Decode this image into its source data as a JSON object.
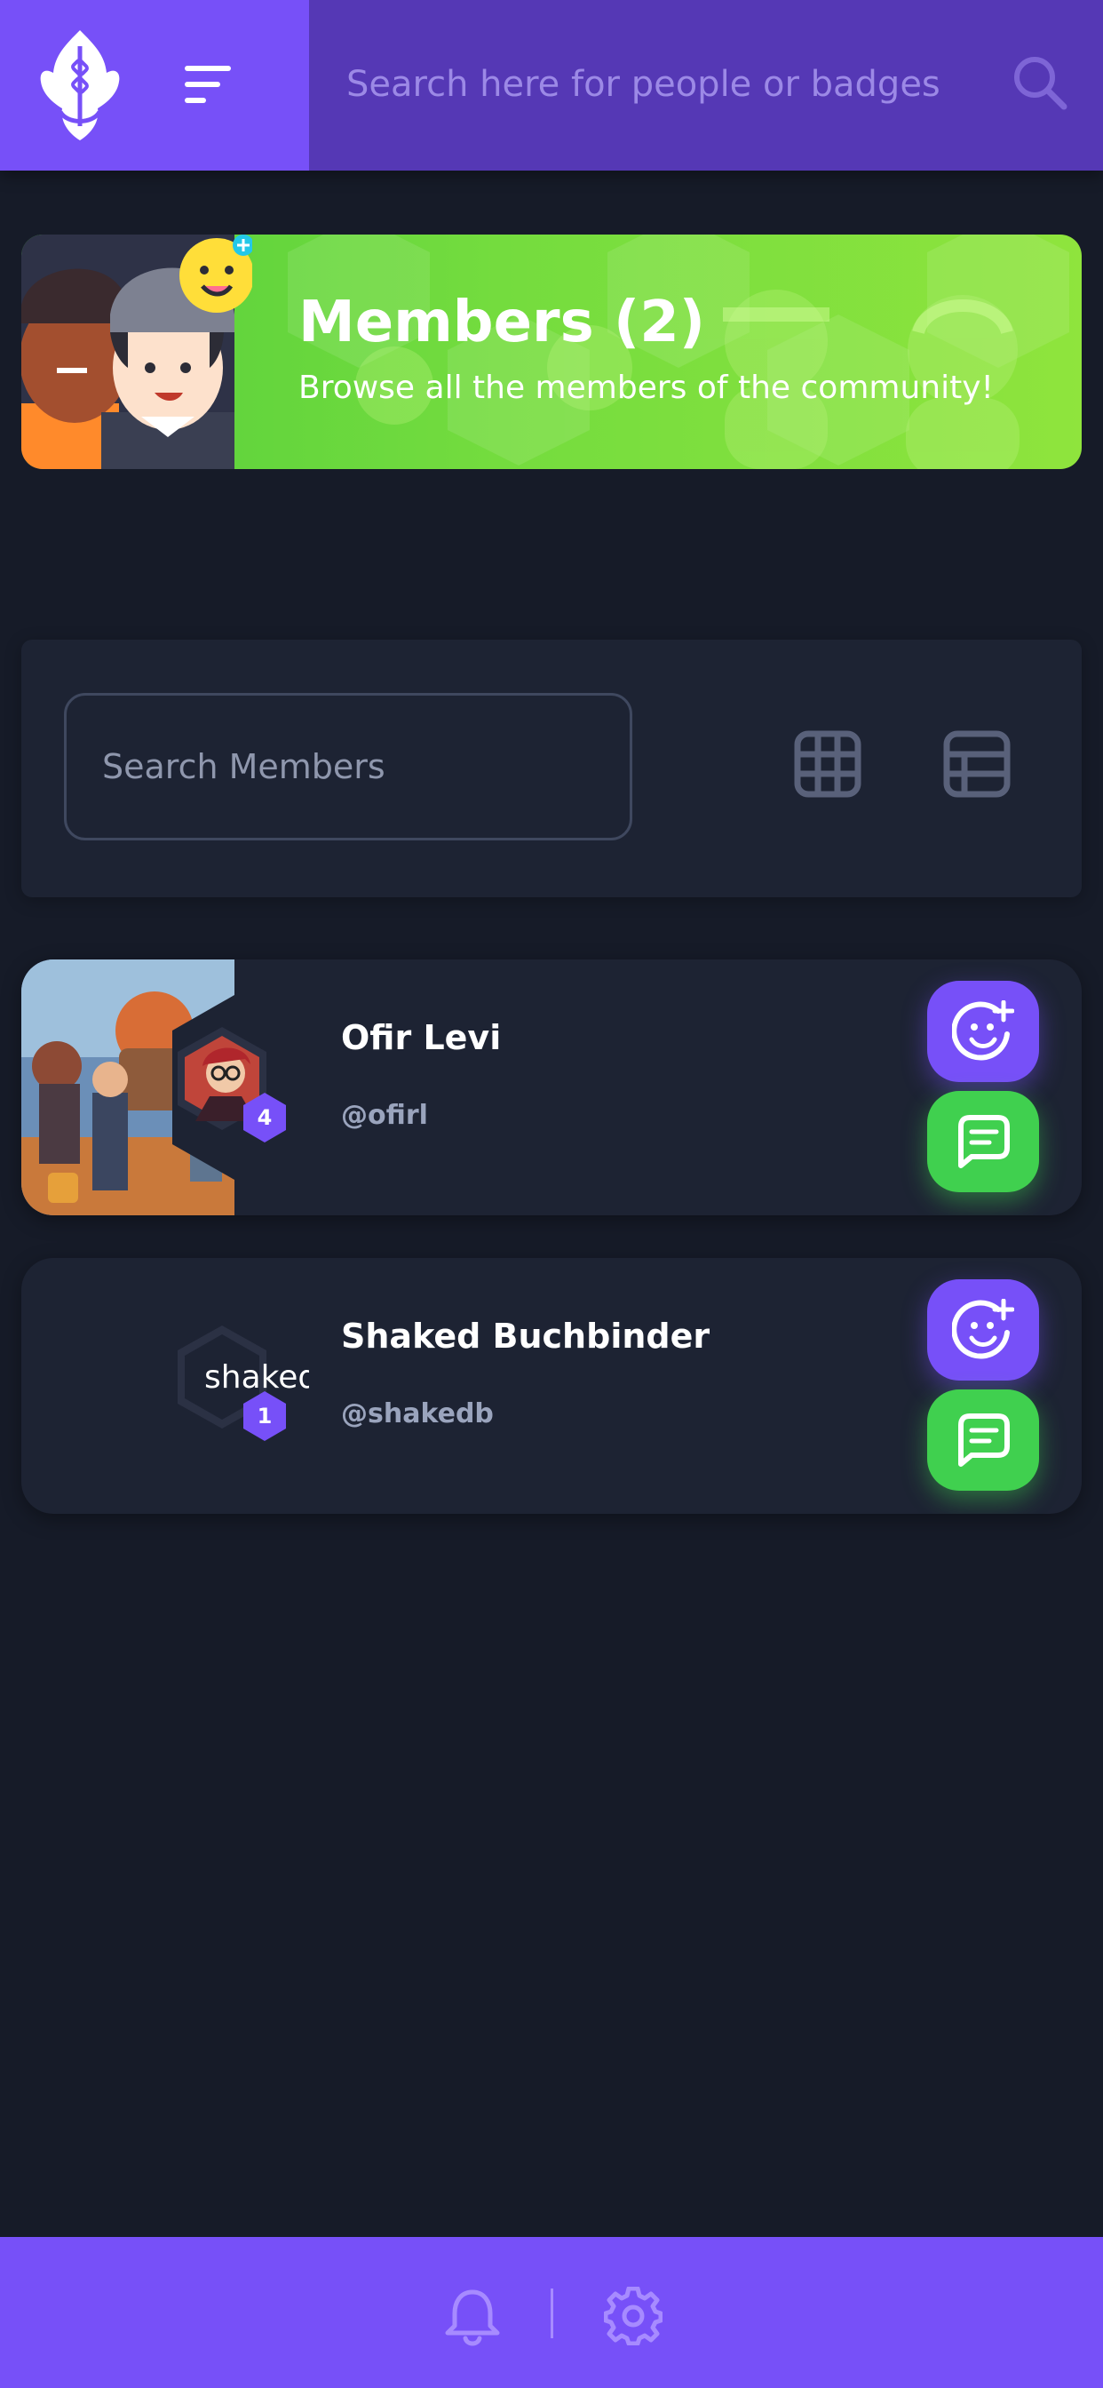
{
  "header": {
    "search_placeholder": "Search here for people or badges",
    "icons": [
      "logo-icon",
      "menu-icon",
      "search-icon"
    ]
  },
  "banner": {
    "title": "Members (2)",
    "description": "Browse all the members of the community!"
  },
  "filter": {
    "search_placeholder": "Search Members",
    "view_options": [
      "grid-view-icon",
      "list-view-icon"
    ]
  },
  "members": [
    {
      "name": "Ofir Levi",
      "handle": "@ofirl",
      "level": "4",
      "avatar_text": ""
    },
    {
      "name": "Shaked Buchbinder",
      "handle": "@shakedb",
      "level": "1",
      "avatar_text": "shaked"
    }
  ],
  "bottom_bar": {
    "icons": [
      "bell-icon",
      "gear-icon"
    ]
  },
  "colors": {
    "page_bg": "#161b28",
    "card_bg": "#1d2333",
    "brand_purple": "#7750f8",
    "header_purple": "#5538b5",
    "banner_green": "#6fd93e",
    "message_green": "#40d04f",
    "muted_text": "#9aa4bd"
  }
}
